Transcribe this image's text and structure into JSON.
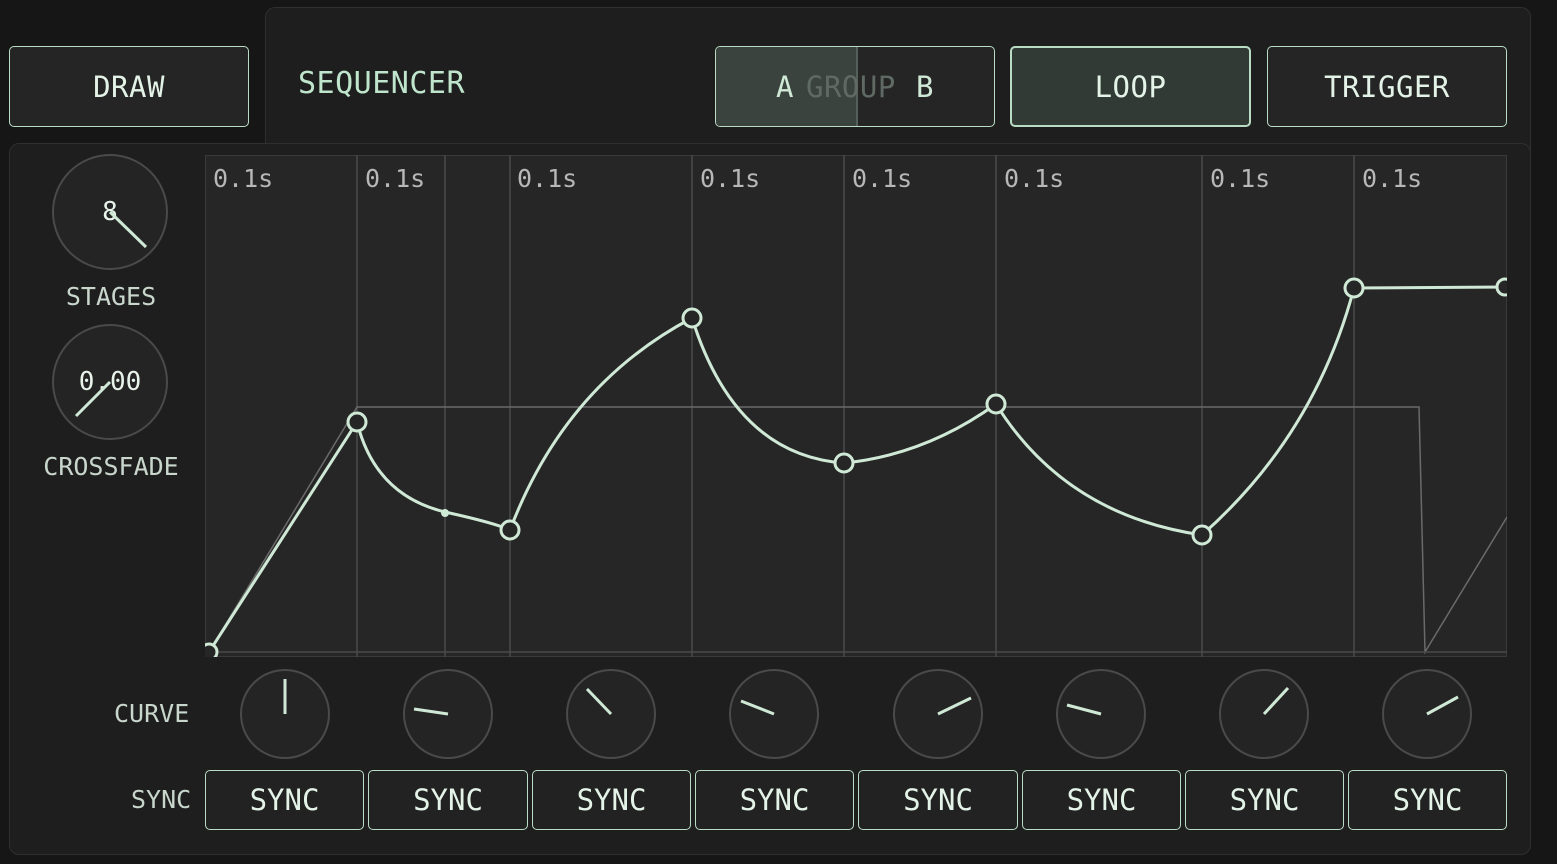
{
  "toolbar": {
    "draw_label": "DRAW",
    "title": "SEQUENCER",
    "group_a": "A",
    "group_label": "GROUP",
    "group_b": "B",
    "loop_label": "LOOP",
    "trigger_label": "TRIGGER"
  },
  "controls": {
    "stages": {
      "label": "STAGES",
      "value": "8"
    },
    "crossfade": {
      "label": "CROSSFADE",
      "value": "0.00"
    }
  },
  "stage_times": [
    "0.1s",
    "0.1s",
    "0.1s",
    "0.1s",
    "0.1s",
    "0.1s",
    "0.1s",
    "0.1s"
  ],
  "rows": {
    "curve_label": "CURVE",
    "sync_label": "SYNC"
  },
  "sync_buttons": [
    "SYNC",
    "SYNC",
    "SYNC",
    "SYNC",
    "SYNC",
    "SYNC",
    "SYNC",
    "SYNC"
  ],
  "colors": {
    "accent": "#cfe9d6",
    "background": "#161616",
    "panel": "#1e1e1e",
    "graph_bg": "#262626",
    "grid": "#4a4a4a"
  }
}
